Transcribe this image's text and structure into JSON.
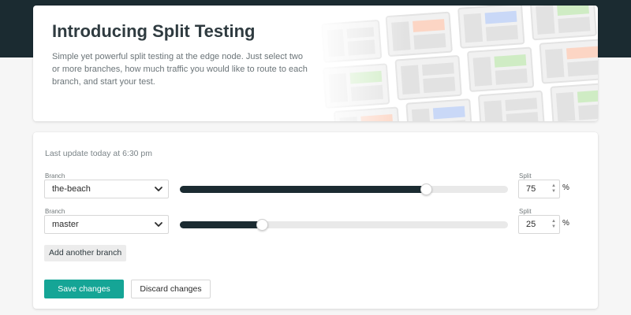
{
  "intro": {
    "title": "Introducing Split Testing",
    "description": "Simple yet powerful split testing at the edge node. Just select two or more branches, how much traffic you would like to route to each branch, and start your test."
  },
  "main": {
    "last_update": "Last update today at 6:30 pm",
    "branch_label": "Branch",
    "split_label": "Split",
    "percent_sign": "%",
    "rows": [
      {
        "branch": "the-beach",
        "split": "75",
        "split_value": 0.75
      },
      {
        "branch": "master",
        "split": "25",
        "split_value": 0.25
      }
    ],
    "add_branch_label": "Add another branch",
    "save_label": "Save changes",
    "discard_label": "Discard changes"
  },
  "colors": {
    "topbar": "#1b2b31",
    "primary": "#15a596",
    "slider_fill": "#1b2b31",
    "illustration_green": "#cfecc4",
    "illustration_orange": "#fcd5c4",
    "illustration_blue": "#c9d8f7"
  }
}
